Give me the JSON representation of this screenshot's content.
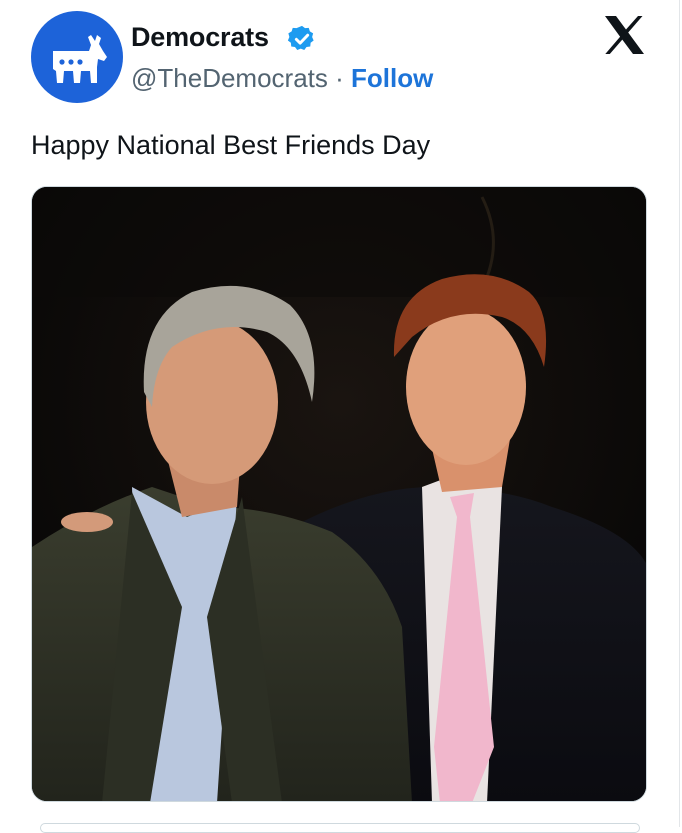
{
  "tweet": {
    "display_name": "Democrats",
    "handle": "@TheDemocrats",
    "separator": "·",
    "follow_label": "Follow",
    "text": "Happy National Best Friends Day"
  },
  "icons": {
    "avatar": "democrats-donkey-logo",
    "verified": "verified-badge-icon",
    "platform": "x-logo-icon"
  },
  "media": {
    "description_type": "photo"
  },
  "colors": {
    "avatar_bg": "#1d63d9",
    "follow": "#1d74d9",
    "verified": "#1d9bf0",
    "text": "#0f1419",
    "secondary_text": "#536471"
  }
}
